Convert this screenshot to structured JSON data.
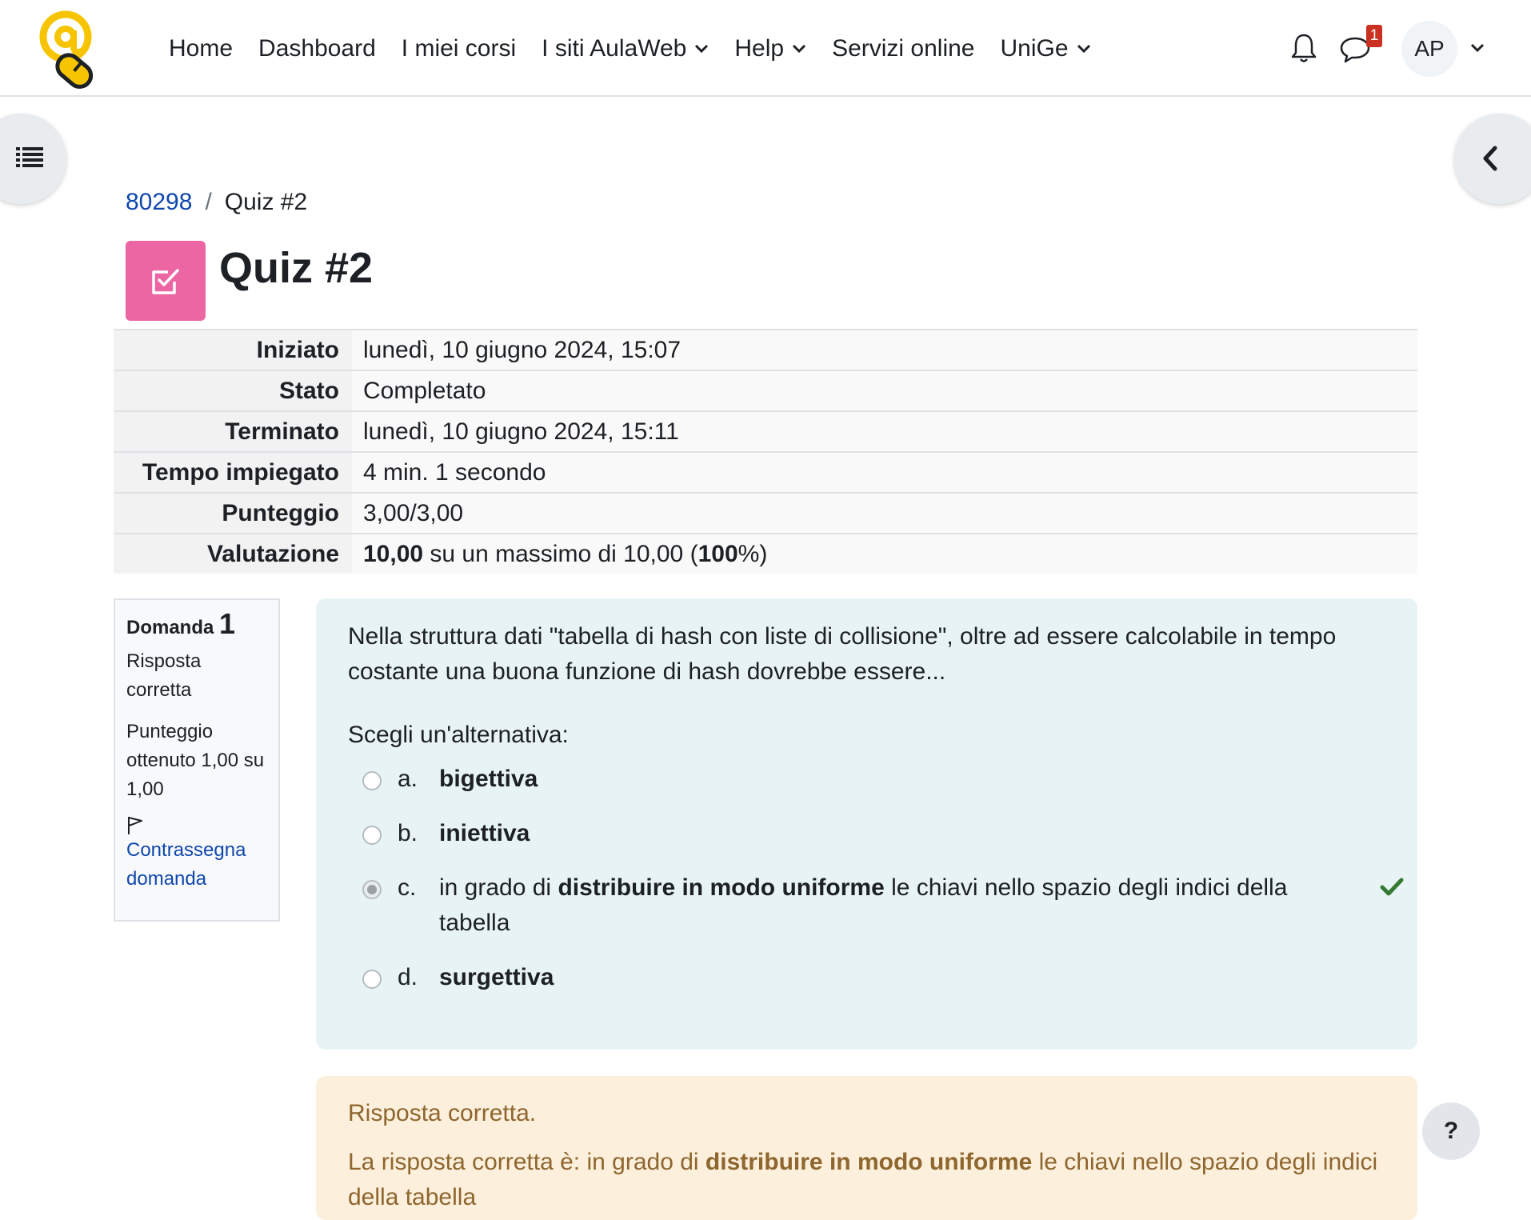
{
  "nav": {
    "items": [
      {
        "label": "Home",
        "dropdown": false
      },
      {
        "label": "Dashboard",
        "dropdown": false
      },
      {
        "label": "I miei corsi",
        "dropdown": false
      },
      {
        "label": "I siti AulaWeb",
        "dropdown": true
      },
      {
        "label": "Help",
        "dropdown": true
      },
      {
        "label": "Servizi online",
        "dropdown": false
      },
      {
        "label": "UniGe",
        "dropdown": true
      }
    ],
    "message_badge": "1",
    "user_initials": "AP"
  },
  "breadcrumb": {
    "course": "80298",
    "current": "Quiz #2"
  },
  "page": {
    "title": "Quiz #2",
    "icon": "quiz-icon",
    "icon_color": "#eb66a2"
  },
  "summary": {
    "rows": [
      {
        "label": "Iniziato",
        "value": "lunedì, 10 giugno 2024, 15:07"
      },
      {
        "label": "Stato",
        "value": "Completato"
      },
      {
        "label": "Terminato",
        "value": "lunedì, 10 giugno 2024, 15:11"
      },
      {
        "label": "Tempo impiegato",
        "value": "4 min. 1 secondo"
      },
      {
        "label": "Punteggio",
        "value": "3,00/3,00"
      }
    ],
    "grade": {
      "label": "Valutazione",
      "score": "10,00",
      "mid": " su un massimo di 10,00 (",
      "percent": "100",
      "end": "%)"
    }
  },
  "question": {
    "label": "Domanda",
    "number": "1",
    "state": "Risposta corretta",
    "grade": "Punteggio ottenuto 1,00 su 1,00",
    "flag_label": "Contrassegna domanda",
    "text": "Nella struttura dati \"tabella di hash con liste di collisione\", oltre ad essere calcolabile in tempo costante una buona funzione di hash dovrebbe essere...",
    "prompt": "Scegli un'alternativa:",
    "options": [
      {
        "letter": "a.",
        "pre": "",
        "bold": "bigettiva",
        "post": "",
        "checked": false,
        "correct": false
      },
      {
        "letter": "b.",
        "pre": "",
        "bold": "iniettiva",
        "post": "",
        "checked": false,
        "correct": false
      },
      {
        "letter": "c.",
        "pre": "in grado di ",
        "bold": "distribuire in modo uniforme",
        "post": " le chiavi nello spazio degli indici della tabella",
        "checked": true,
        "correct": true
      },
      {
        "letter": "d.",
        "pre": "",
        "bold": "surgettiva",
        "post": "",
        "checked": false,
        "correct": false
      }
    ]
  },
  "feedback": {
    "status": "Risposta corretta.",
    "answer_pre": "La risposta corretta è: in grado di ",
    "answer_bold": "distribuire in modo uniforme",
    "answer_post": " le chiavi nello spazio degli indici della tabella"
  },
  "help": {
    "label": "?"
  },
  "colors": {
    "link": "#0f47ad",
    "question_bg": "#e7f3f5",
    "feedback_bg": "#fcefdc",
    "feedback_text": "#8e662e",
    "correct_check": "#357a32",
    "badge": "#ca3120"
  }
}
